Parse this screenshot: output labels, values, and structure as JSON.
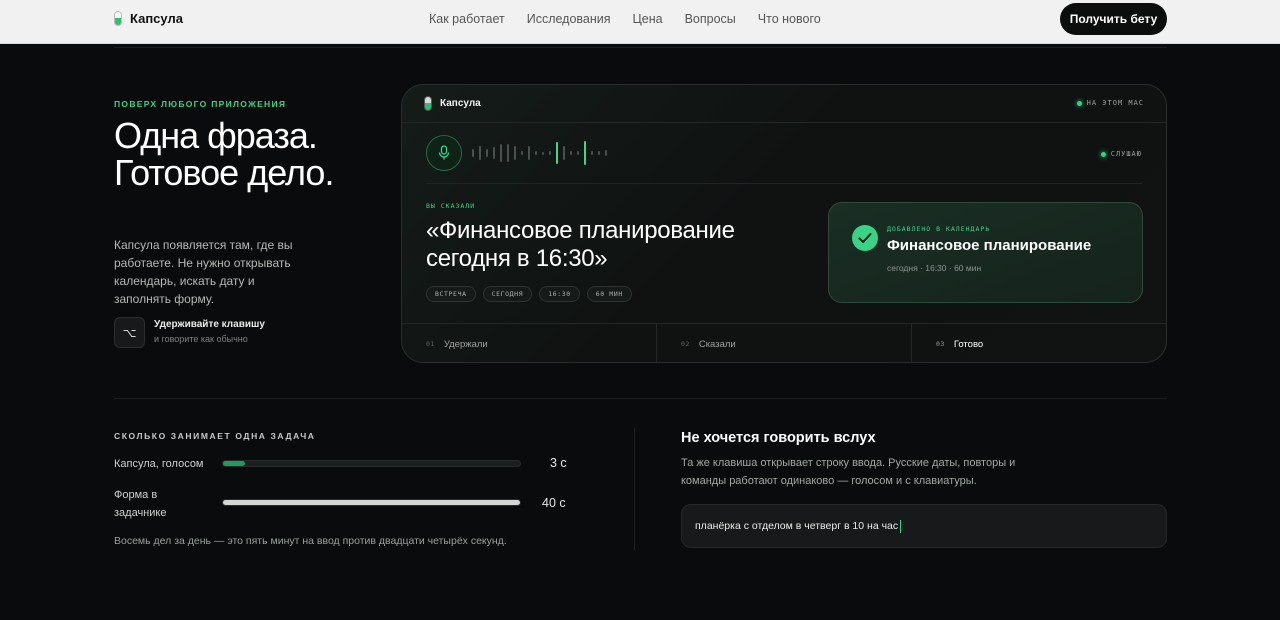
{
  "nav": {
    "brand": "Капсула",
    "links": [
      "Как работает",
      "Исследования",
      "Цена",
      "Вопросы",
      "Что нового"
    ],
    "cta": "Получить бету"
  },
  "hero": {
    "eyebrow": "ПОВЕРХ ЛЮБОГО ПРИЛОЖЕНИЯ",
    "headline": "Одна фраза. Готовое дело.",
    "lead": "Капсула появляется там, где вы работаете. Не нужно открывать календарь, искать дату и заполнять форму.",
    "key_symbol": "⌥",
    "hold_title": "Удерживайте клавишу",
    "hold_subtitle": "и говорите как обычно"
  },
  "app": {
    "brand": "Капсула",
    "status_top": "НА ЭТОМ MAC",
    "status_listen": "СЛУШАЮ",
    "you_said_label": "ВЫ СКАЗАЛИ",
    "phrase": "«Финансовое планирование сегодня в 16:30»",
    "chips": [
      "ВСТРЕЧА",
      "СЕГОДНЯ",
      "16:30",
      "60 МИН"
    ],
    "added_label": "ДОБАВЛЕНО В КАЛЕНДАРЬ",
    "added_title": "Финансовое планирование",
    "added_meta": "сегодня · 16:30 · 60 мин",
    "steps": [
      {
        "num": "01",
        "label": "Удержали"
      },
      {
        "num": "02",
        "label": "Сказали"
      },
      {
        "num": "03",
        "label": "Готово"
      }
    ]
  },
  "comparison": {
    "label": "СКОЛЬКО ЗАНИМАЕТ ОДНА ЗАДАЧА",
    "rows": [
      {
        "label": "Капсула, голосом",
        "value": "3 с",
        "fraction": 0.075,
        "color": "#1f9a5c"
      },
      {
        "label": "Форма в задачнике",
        "value": "40 с",
        "fraction": 1.0,
        "color": "#d4d6d5"
      }
    ],
    "note": "Восемь дел за день — это пять минут на ввод против двадцати четырёх секунд."
  },
  "typing": {
    "title": "Не хочется говорить вслух",
    "description": "Та же клавиша открывает строку ввода. Русские даты, повторы и команды работают одинаково — голосом и с клавиатуры.",
    "input_value": "планёрка с отделом в четверг в 10 на час"
  },
  "colors": {
    "accent": "#3fd286",
    "background": "#0a0b0c",
    "nav_background": "#f1f1f1"
  }
}
